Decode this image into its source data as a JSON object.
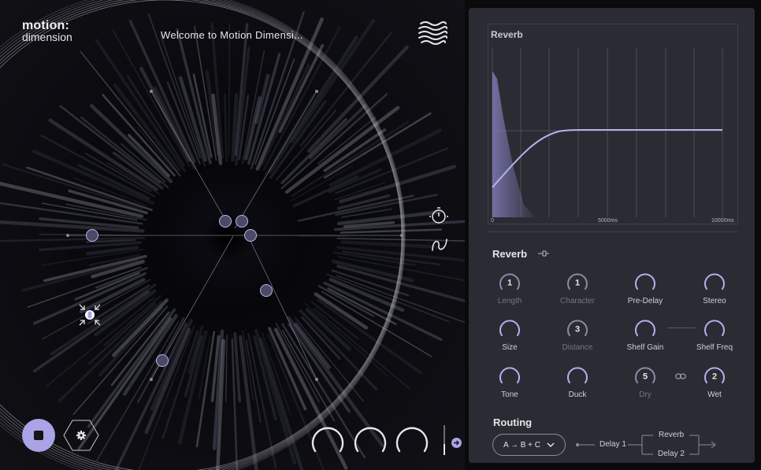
{
  "app": {
    "logo_line1": "motion:",
    "logo_line2": "dimension",
    "welcome": "Welcome to Motion Dimensi..."
  },
  "colors": {
    "accent": "#a9a4e6",
    "panel_bg": "#2b2c33",
    "stage_bg": "#0a0a0d"
  },
  "icons": {
    "waves": "waves-icon",
    "timer": "timer-icon",
    "curve": "curve-icon",
    "stop": "stop-icon",
    "gear": "gear-icon",
    "arrow": "arrow-right-icon",
    "plug": "plug-icon",
    "chain": "chain-link-icon",
    "chevron": "chevron-down-icon"
  },
  "graph": {
    "title": "Reverb",
    "x_ticks": [
      "0",
      "5000ms",
      "10000ms"
    ]
  },
  "reverb": {
    "title": "Reverb",
    "params": [
      {
        "label": "Length",
        "value": "1",
        "enabled": false
      },
      {
        "label": "Character",
        "value": "1",
        "enabled": false
      },
      {
        "label": "Pre-Delay",
        "value": "",
        "enabled": true
      },
      {
        "label": "Stereo",
        "value": "",
        "enabled": true
      },
      {
        "label": "Size",
        "value": "",
        "enabled": true
      },
      {
        "label": "Distance",
        "value": "3",
        "enabled": false
      },
      {
        "label": "Shelf Gain",
        "value": "",
        "enabled": true
      },
      {
        "label": "Shelf Freq",
        "value": "",
        "enabled": true
      },
      {
        "label": "Tone",
        "value": "",
        "enabled": true
      },
      {
        "label": "Duck",
        "value": "",
        "enabled": true
      },
      {
        "label": "Dry",
        "value": "5",
        "enabled": false
      },
      {
        "label": "Wet",
        "value": "2",
        "enabled": true
      }
    ]
  },
  "routing": {
    "title": "Routing",
    "selected": "A → B + C",
    "node_a": "Delay 1",
    "node_b": "Reverb",
    "node_c": "Delay 2"
  }
}
